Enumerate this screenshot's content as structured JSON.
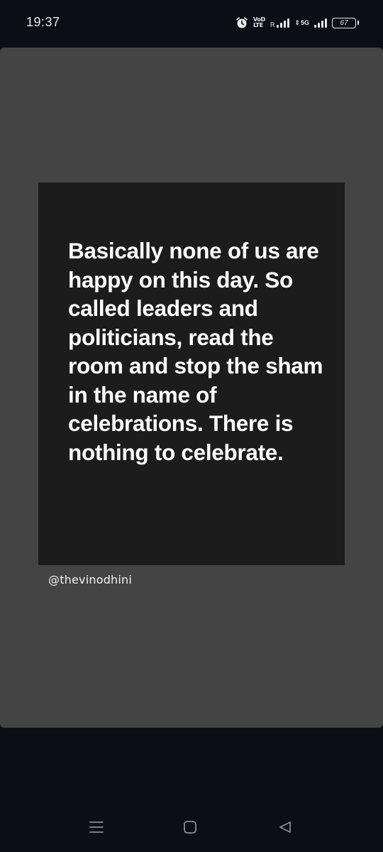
{
  "status_bar": {
    "time": "19:37",
    "volte_top": "VoD",
    "volte_bottom": "LTE",
    "sim1_label": "R",
    "network_type": "5G",
    "battery": "67"
  },
  "post": {
    "quote": "Basically none of us are happy on this day. So called leaders and politicians, read the room and stop the sham in the name of celebrations. There is nothing to celebrate.",
    "handle": "@thevinodhini"
  },
  "nav_bar": {
    "icons": [
      "menu-icon",
      "home-icon",
      "back-icon"
    ]
  },
  "colors": {
    "background": "#0b0e14",
    "card": "#444444",
    "quote_box": "#1c1c1c",
    "text": "#ffffff"
  }
}
